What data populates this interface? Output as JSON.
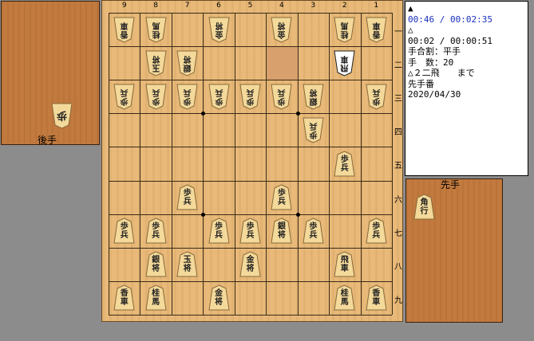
{
  "gote_stand": {
    "label": "後手",
    "pieces": [
      {
        "chars": [
          "歩"
        ],
        "count": "",
        "promoted": false
      }
    ]
  },
  "sente_stand": {
    "label": "先手",
    "pieces": [
      {
        "chars": [
          "角",
          "行"
        ],
        "count": "",
        "promoted": false
      }
    ]
  },
  "board": {
    "col_labels": [
      "9",
      "8",
      "7",
      "6",
      "5",
      "4",
      "3",
      "2",
      "1"
    ],
    "row_labels": [
      "一",
      "二",
      "三",
      "四",
      "五",
      "六",
      "七",
      "八",
      "九"
    ],
    "pieces": [
      {
        "file": 9,
        "rank": 1,
        "chars": [
          "香",
          "車"
        ],
        "side": "gote"
      },
      {
        "file": 8,
        "rank": 1,
        "chars": [
          "桂",
          "馬"
        ],
        "side": "gote"
      },
      {
        "file": 6,
        "rank": 1,
        "chars": [
          "金",
          "将"
        ],
        "side": "gote"
      },
      {
        "file": 4,
        "rank": 1,
        "chars": [
          "金",
          "将"
        ],
        "side": "gote"
      },
      {
        "file": 2,
        "rank": 1,
        "chars": [
          "桂",
          "馬"
        ],
        "side": "gote"
      },
      {
        "file": 1,
        "rank": 1,
        "chars": [
          "香",
          "車"
        ],
        "side": "gote"
      },
      {
        "file": 8,
        "rank": 2,
        "chars": [
          "玉",
          "将"
        ],
        "side": "gote"
      },
      {
        "file": 7,
        "rank": 2,
        "chars": [
          "銀",
          "将"
        ],
        "side": "gote"
      },
      {
        "file": 2,
        "rank": 2,
        "chars": [
          "飛",
          "車"
        ],
        "side": "gote",
        "selected": true
      },
      {
        "file": 9,
        "rank": 3,
        "chars": [
          "歩",
          "兵"
        ],
        "side": "gote"
      },
      {
        "file": 8,
        "rank": 3,
        "chars": [
          "歩",
          "兵"
        ],
        "side": "gote"
      },
      {
        "file": 7,
        "rank": 3,
        "chars": [
          "歩",
          "兵"
        ],
        "side": "gote"
      },
      {
        "file": 6,
        "rank": 3,
        "chars": [
          "歩",
          "兵"
        ],
        "side": "gote"
      },
      {
        "file": 5,
        "rank": 3,
        "chars": [
          "歩",
          "兵"
        ],
        "side": "gote"
      },
      {
        "file": 4,
        "rank": 3,
        "chars": [
          "歩",
          "兵"
        ],
        "side": "gote"
      },
      {
        "file": 3,
        "rank": 3,
        "chars": [
          "銀",
          "将"
        ],
        "side": "gote"
      },
      {
        "file": 1,
        "rank": 3,
        "chars": [
          "歩",
          "兵"
        ],
        "side": "gote"
      },
      {
        "file": 3,
        "rank": 4,
        "chars": [
          "歩",
          "兵"
        ],
        "side": "gote"
      },
      {
        "file": 2,
        "rank": 5,
        "chars": [
          "歩",
          "兵"
        ],
        "side": "sente"
      },
      {
        "file": 7,
        "rank": 6,
        "chars": [
          "歩",
          "兵"
        ],
        "side": "sente"
      },
      {
        "file": 4,
        "rank": 6,
        "chars": [
          "歩",
          "兵"
        ],
        "side": "sente"
      },
      {
        "file": 9,
        "rank": 7,
        "chars": [
          "歩",
          "兵"
        ],
        "side": "sente"
      },
      {
        "file": 8,
        "rank": 7,
        "chars": [
          "歩",
          "兵"
        ],
        "side": "sente"
      },
      {
        "file": 6,
        "rank": 7,
        "chars": [
          "歩",
          "兵"
        ],
        "side": "sente"
      },
      {
        "file": 5,
        "rank": 7,
        "chars": [
          "歩",
          "兵"
        ],
        "side": "sente"
      },
      {
        "file": 4,
        "rank": 7,
        "chars": [
          "銀",
          "将"
        ],
        "side": "sente"
      },
      {
        "file": 3,
        "rank": 7,
        "chars": [
          "歩",
          "兵"
        ],
        "side": "sente"
      },
      {
        "file": 1,
        "rank": 7,
        "chars": [
          "歩",
          "兵"
        ],
        "side": "sente"
      },
      {
        "file": 8,
        "rank": 8,
        "chars": [
          "銀",
          "将"
        ],
        "side": "sente"
      },
      {
        "file": 7,
        "rank": 8,
        "chars": [
          "玉",
          "将"
        ],
        "side": "sente"
      },
      {
        "file": 5,
        "rank": 8,
        "chars": [
          "金",
          "将"
        ],
        "side": "sente"
      },
      {
        "file": 2,
        "rank": 8,
        "chars": [
          "飛",
          "車"
        ],
        "side": "sente"
      },
      {
        "file": 9,
        "rank": 9,
        "chars": [
          "香",
          "車"
        ],
        "side": "sente"
      },
      {
        "file": 8,
        "rank": 9,
        "chars": [
          "桂",
          "馬"
        ],
        "side": "sente"
      },
      {
        "file": 6,
        "rank": 9,
        "chars": [
          "金",
          "将"
        ],
        "side": "sente"
      },
      {
        "file": 2,
        "rank": 9,
        "chars": [
          "桂",
          "馬"
        ],
        "side": "sente"
      },
      {
        "file": 1,
        "rank": 9,
        "chars": [
          "香",
          "車"
        ],
        "side": "sente"
      }
    ],
    "last_move_square": {
      "file": 4,
      "rank": 2
    },
    "colors": {
      "board": "#e8b978",
      "highlight": "#d8a06c",
      "stand": "#c27a3e",
      "piece": "#f3d99a"
    }
  },
  "info": {
    "sente_mark": "▲",
    "sente_time": "00:46 / 00:02:35",
    "gote_mark": "△",
    "gote_time": "00:02 / 00:00:51",
    "handicap": "手合割：平手",
    "move_count": "手　数：20",
    "last_move": "△２二飛　　まで",
    "turn": "先手番",
    "date": "2020/04/30"
  }
}
